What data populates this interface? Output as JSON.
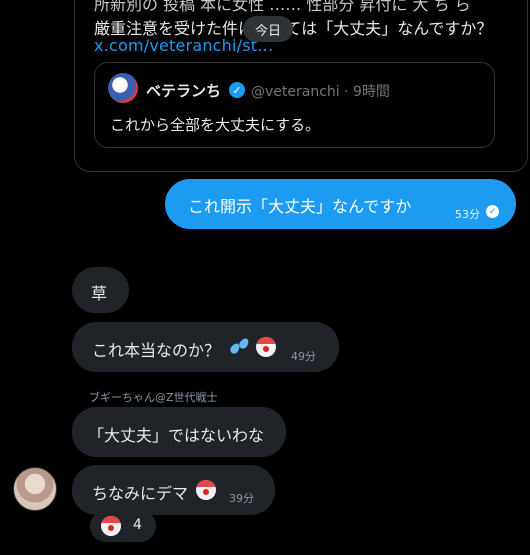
{
  "shared_post": {
    "line1": "所新別の 投稿 本に女性 …… 性部分 昇付に 大 ち ら",
    "line2": "厳重注意を受けた件に関しては「大丈夫」なんですか？",
    "link": "x.com/veteranchi/st..."
  },
  "date_divider": "今日",
  "quote": {
    "name": "ベテランち",
    "handle_time": "@veteranchi · 9時間",
    "text": "これから全部を大丈夫にする。"
  },
  "sent_message": {
    "text": "これ開示「大丈夫」なんですか",
    "time": "53分",
    "check": "✓"
  },
  "received": [
    {
      "text": "草"
    },
    {
      "text": "これ本当なのか？",
      "time": "49分"
    },
    {
      "text": "「大丈夫」ではないわな"
    },
    {
      "text": "ちなみにデマ",
      "time": "39分"
    }
  ],
  "sender_name": "ブギーちゃん@Z世代戦士",
  "reaction": {
    "emoji": "clown-face",
    "count": "4"
  },
  "icons": {
    "verified": "verified-badge-icon",
    "sweat": "sweat-droplets-icon",
    "clown": "clown-face-icon"
  },
  "colors": {
    "accent": "#1d9bf0",
    "bubble_received": "#202327",
    "background": "#000000"
  }
}
